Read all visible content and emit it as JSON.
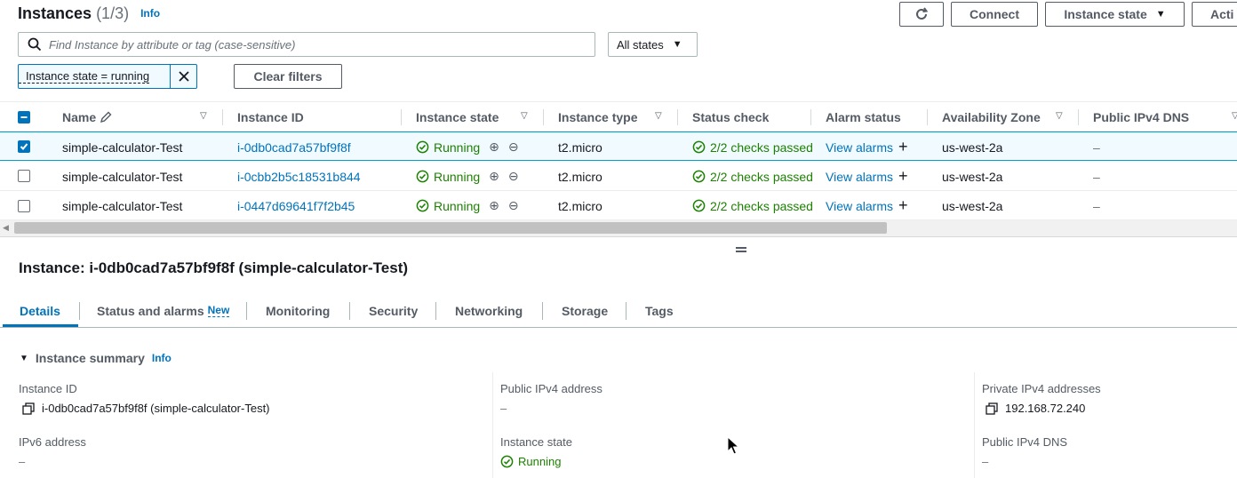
{
  "header": {
    "title": "Instances",
    "count": "(1/3)",
    "info": "Info",
    "buttons": {
      "connect": "Connect",
      "instance_state": "Instance state",
      "actions": "Acti"
    }
  },
  "filters": {
    "search_placeholder": "Find Instance by attribute or tag (case-sensitive)",
    "state_select": "All states",
    "token": "Instance state = running",
    "clear": "Clear filters"
  },
  "table": {
    "columns": [
      "Name",
      "Instance ID",
      "Instance state",
      "Instance type",
      "Status check",
      "Alarm status",
      "Availability Zone",
      "Public IPv4 DNS"
    ],
    "rows": [
      {
        "name": "simple-calculator-Test",
        "id": "i-0db0cad7a57bf9f8f",
        "state": "Running",
        "type": "t2.micro",
        "status": "2/2 checks passed",
        "alarm": "View alarms",
        "az": "us-west-2a",
        "dns": "–",
        "selected": true
      },
      {
        "name": "simple-calculator-Test",
        "id": "i-0cbb2b5c18531b844",
        "state": "Running",
        "type": "t2.micro",
        "status": "2/2 checks passed",
        "alarm": "View alarms",
        "az": "us-west-2a",
        "dns": "–",
        "selected": false
      },
      {
        "name": "simple-calculator-Test",
        "id": "i-0447d69641f7f2b45",
        "state": "Running",
        "type": "t2.micro",
        "status": "2/2 checks passed",
        "alarm": "View alarms",
        "az": "us-west-2a",
        "dns": "–",
        "selected": false
      }
    ]
  },
  "details": {
    "title": "Instance: i-0db0cad7a57bf9f8f (simple-calculator-Test)",
    "tabs": [
      "Details",
      "Status and alarms",
      "Monitoring",
      "Security",
      "Networking",
      "Storage",
      "Tags"
    ],
    "new_badge": "New",
    "section": "Instance summary",
    "section_info": "Info",
    "fields": {
      "instance_id_label": "Instance ID",
      "instance_id_value": "i-0db0cad7a57bf9f8f (simple-calculator-Test)",
      "public_ipv4_label": "Public IPv4 address",
      "public_ipv4_value": "–",
      "private_ipv4_label": "Private IPv4 addresses",
      "private_ipv4_value": "192.168.72.240",
      "ipv6_label": "IPv6 address",
      "ipv6_value": "–",
      "state_label": "Instance state",
      "state_value": "Running",
      "public_dns_label": "Public IPv4 DNS",
      "public_dns_value": "–"
    }
  },
  "colors": {
    "accent": "#0073bb",
    "success": "#1d8102",
    "text": "#16191f",
    "muted": "#545b64"
  }
}
